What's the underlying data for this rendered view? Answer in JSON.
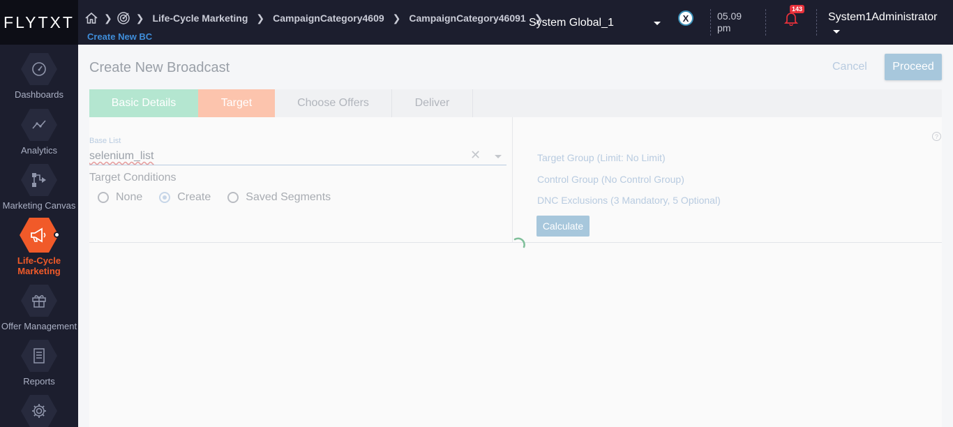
{
  "header": {
    "logo": "FLYTXT",
    "breadcrumbs": [
      "Life-Cycle Marketing",
      "CampaignCategory4609",
      "CampaignCategory46091"
    ],
    "sub_crumb": "Create New BC",
    "tenant": "System Global_1",
    "time": "05.09",
    "time_period": "pm",
    "notification_count": "143",
    "user": "System1Administrator"
  },
  "sidebar": {
    "items": [
      {
        "label": "Dashboards",
        "icon": "dashboard-gauge-icon"
      },
      {
        "label": "Analytics",
        "icon": "analytics-line-icon"
      },
      {
        "label": "Marketing Canvas",
        "icon": "canvas-flow-icon"
      },
      {
        "label": "Life-Cycle Marketing",
        "icon": "megaphone-icon",
        "active": true
      },
      {
        "label": "Offer Management",
        "icon": "gift-icon"
      },
      {
        "label": "Reports",
        "icon": "report-document-icon"
      },
      {
        "label": "",
        "icon": "settings-gear-icon"
      }
    ]
  },
  "page": {
    "title": "Create New Broadcast",
    "cancel_label": "Cancel",
    "proceed_label": "Proceed"
  },
  "steps": [
    {
      "label": "Basic Details",
      "state": "done"
    },
    {
      "label": "Target",
      "state": "current"
    },
    {
      "label": "Choose Offers",
      "state": "pending"
    },
    {
      "label": "Deliver",
      "state": "pending"
    }
  ],
  "target": {
    "base_list_label": "Base List",
    "base_list_value": "selenium_list",
    "conditions_label": "Target Conditions",
    "options": [
      "None",
      "Create",
      "Saved Segments"
    ],
    "selected_option": "Create",
    "target_group": "Target Group (Limit: No Limit)",
    "control_group": "Control Group (No Control Group)",
    "dnc_exclusions": "DNC Exclusions (3 Mandatory, 5 Optional)",
    "calculate_label": "Calculate",
    "help": "?"
  },
  "colors": {
    "nav_bg": "#1c1e2e",
    "accent": "#f15a29",
    "link": "#3f8dd9",
    "step_done": "#b4e6d0",
    "step_current": "#fcc4ad",
    "button": "#a7c7dc"
  }
}
